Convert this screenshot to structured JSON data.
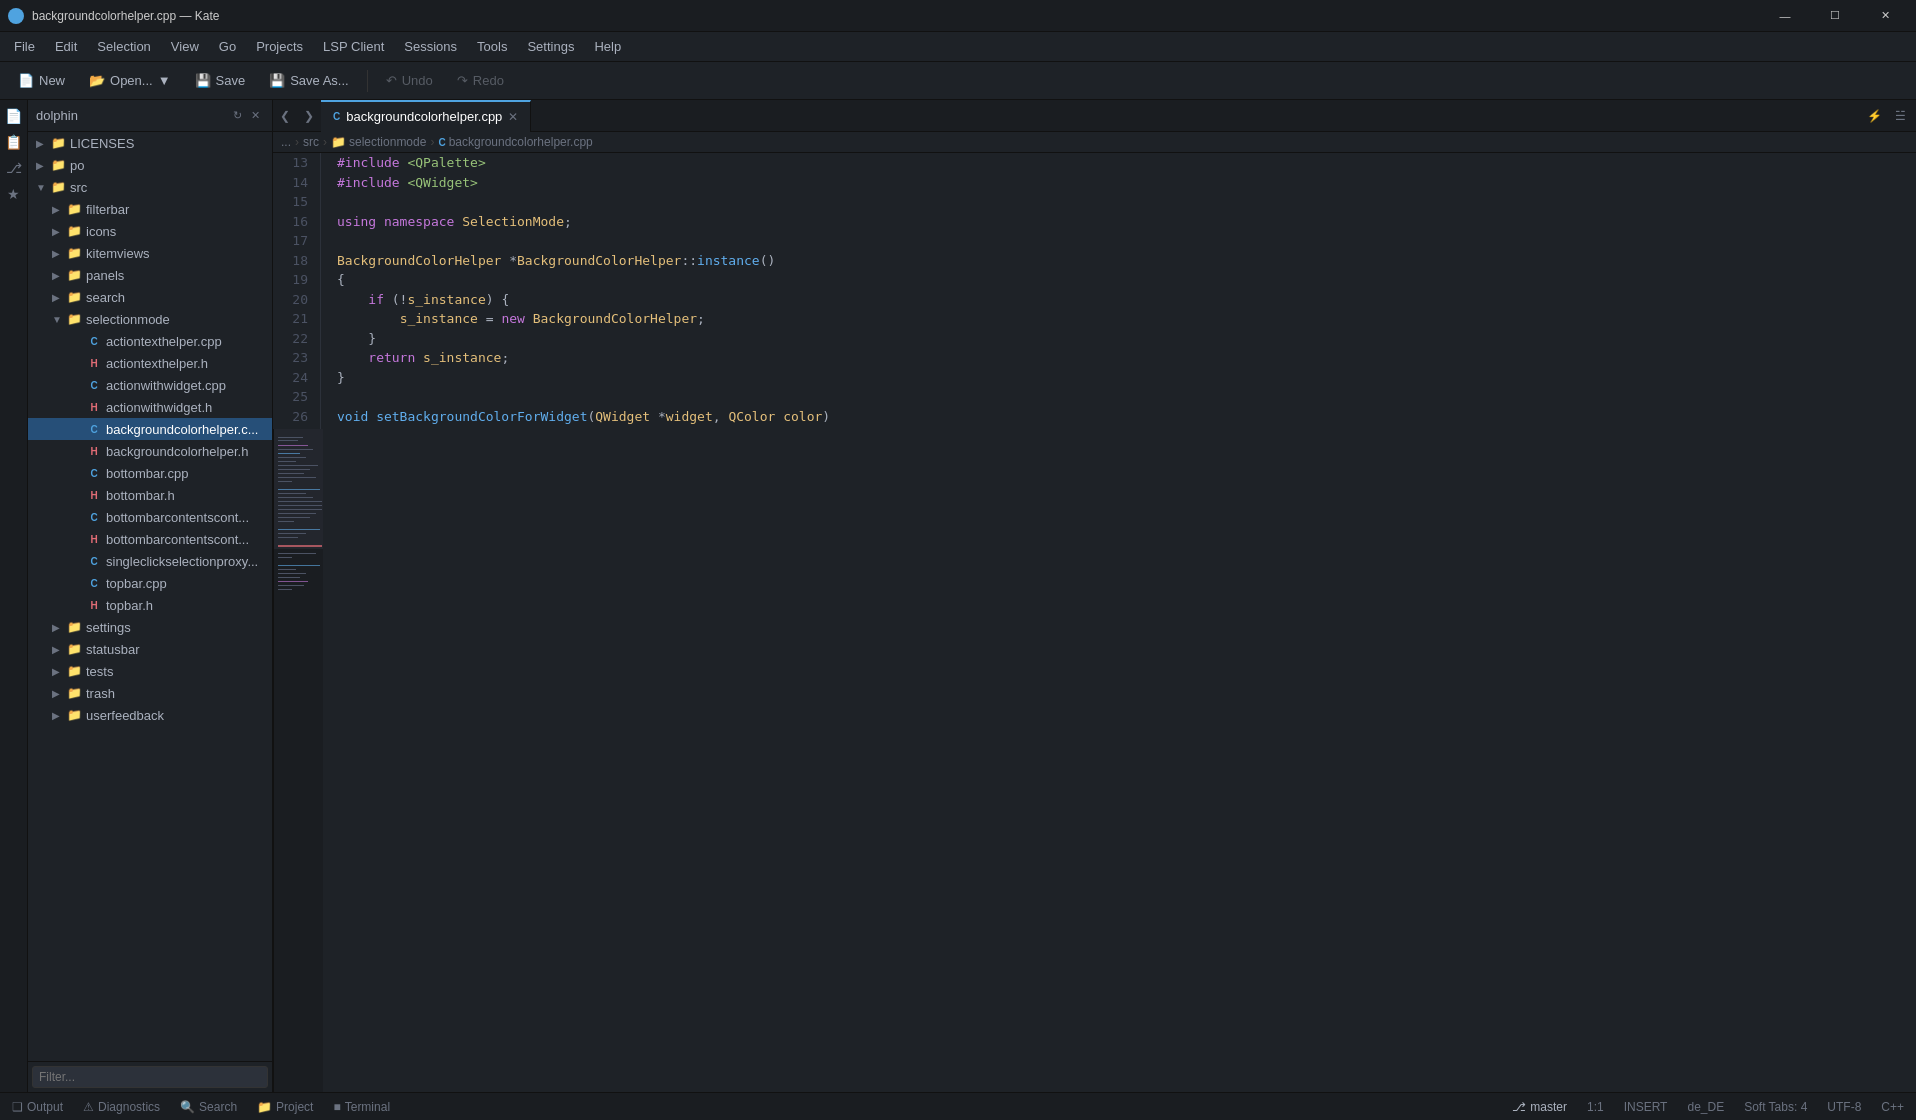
{
  "titlebar": {
    "title": "backgroundcolorhelper.cpp — Kate",
    "app_name": "Kate"
  },
  "menubar": {
    "items": [
      "File",
      "Edit",
      "Selection",
      "View",
      "Go",
      "Projects",
      "LSP Client",
      "Sessions",
      "Tools",
      "Settings",
      "Help"
    ]
  },
  "toolbar": {
    "new_label": "New",
    "open_label": "Open...",
    "save_label": "Save",
    "saveas_label": "Save As...",
    "undo_label": "Undo",
    "redo_label": "Redo"
  },
  "file_panel": {
    "title": "dolphin",
    "filter_placeholder": "Filter...",
    "tree": [
      {
        "label": "LICENSES",
        "type": "folder",
        "level": 1,
        "expanded": false
      },
      {
        "label": "po",
        "type": "folder",
        "level": 1,
        "expanded": false
      },
      {
        "label": "src",
        "type": "folder",
        "level": 1,
        "expanded": true
      },
      {
        "label": "filterbar",
        "type": "folder",
        "level": 2,
        "expanded": false
      },
      {
        "label": "icons",
        "type": "folder",
        "level": 2,
        "expanded": false
      },
      {
        "label": "kitemviews",
        "type": "folder",
        "level": 2,
        "expanded": false
      },
      {
        "label": "panels",
        "type": "folder",
        "level": 2,
        "expanded": false
      },
      {
        "label": "search",
        "type": "folder",
        "level": 2,
        "expanded": false
      },
      {
        "label": "selectionmode",
        "type": "folder",
        "level": 2,
        "expanded": true
      },
      {
        "label": "actiontexthelper.cpp",
        "type": "cpp",
        "level": 3
      },
      {
        "label": "actiontexthelper.h",
        "type": "h",
        "level": 3
      },
      {
        "label": "actionwithwidget.cpp",
        "type": "cpp",
        "level": 3
      },
      {
        "label": "actionwithwidget.h",
        "type": "h",
        "level": 3
      },
      {
        "label": "backgroundcolorhelper.c...",
        "type": "cpp",
        "level": 3,
        "active": true
      },
      {
        "label": "backgroundcolorhelper.h",
        "type": "h",
        "level": 3
      },
      {
        "label": "bottombar.cpp",
        "type": "cpp",
        "level": 3
      },
      {
        "label": "bottombar.h",
        "type": "h",
        "level": 3
      },
      {
        "label": "bottombarcontentscont...",
        "type": "cpp",
        "level": 3
      },
      {
        "label": "bottombarcontentscont...",
        "type": "h",
        "level": 3
      },
      {
        "label": "singleclickselectionproxy...",
        "type": "cpp",
        "level": 3
      },
      {
        "label": "topbar.cpp",
        "type": "cpp",
        "level": 3
      },
      {
        "label": "topbar.h",
        "type": "h",
        "level": 3
      },
      {
        "label": "settings",
        "type": "folder",
        "level": 2,
        "expanded": false
      },
      {
        "label": "statusbar",
        "type": "folder",
        "level": 2,
        "expanded": false
      },
      {
        "label": "tests",
        "type": "folder",
        "level": 2,
        "expanded": false
      },
      {
        "label": "trash",
        "type": "folder",
        "level": 2,
        "expanded": false
      },
      {
        "label": "userfeedback",
        "type": "folder",
        "level": 2,
        "expanded": false
      }
    ]
  },
  "editor": {
    "filename": "backgroundcolorhelper.cpp",
    "breadcrumb": [
      "...",
      "src",
      "selectionmode",
      "backgroundcolorhelper.cpp"
    ],
    "tab_label": "backgroundcolorhelper.cpp"
  },
  "statusbar": {
    "branch": "master",
    "position": "1:1",
    "insert_mode": "INSERT",
    "language": "de_DE",
    "tab_mode": "Soft Tabs: 4",
    "encoding": "UTF-8",
    "file_type": "C++",
    "output_label": "Output",
    "diagnostics_label": "Diagnostics",
    "search_label": "Search",
    "project_label": "Project",
    "terminal_label": "Terminal"
  }
}
